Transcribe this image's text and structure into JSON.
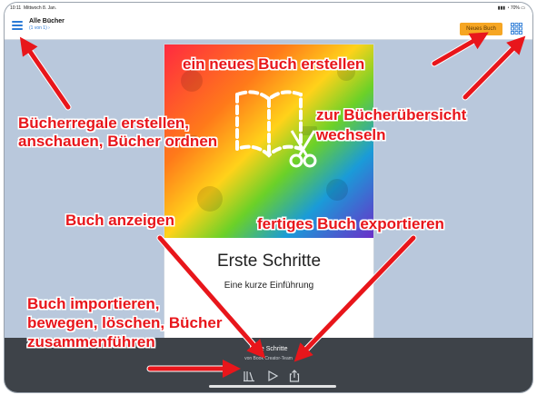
{
  "statusbar": {
    "time": "10:11",
    "date": "Mittwoch 8. Jan.",
    "right": "70%"
  },
  "header": {
    "title": "Alle Bücher",
    "subtitle": "(1 von 1) ›",
    "new_book_label": "Neues Buch"
  },
  "book": {
    "title": "Erste Schritte",
    "subtitle": "Eine kurze Einführung"
  },
  "bottombar": {
    "title": "Erste Schritte",
    "author": "von Book Creator-Team"
  },
  "annotations": {
    "new_book": "ein neues Buch erstellen",
    "shelves_line1": "Bücherregale erstellen,",
    "shelves_line2": "anschauen, Bücher ordnen",
    "overview_line1": "zur Bücherübersicht",
    "overview_line2": "wechseln",
    "show_book": "Buch anzeigen",
    "export": "fertiges Buch exportieren",
    "import_line1": "Buch importieren,",
    "import_line2": "bewegen, löschen, Bücher",
    "import_line3": "zusammenführen"
  },
  "colors": {
    "accent": "#2a7ad6",
    "new_book_button": "#f6a623",
    "annotation": "#e8161b",
    "background": "#b9c8dc",
    "bottombar": "#3e4349"
  },
  "icons": [
    "hamburger-icon",
    "grid-icon",
    "library-icon",
    "play-icon",
    "share-icon",
    "scissors-icon",
    "book-icon"
  ]
}
